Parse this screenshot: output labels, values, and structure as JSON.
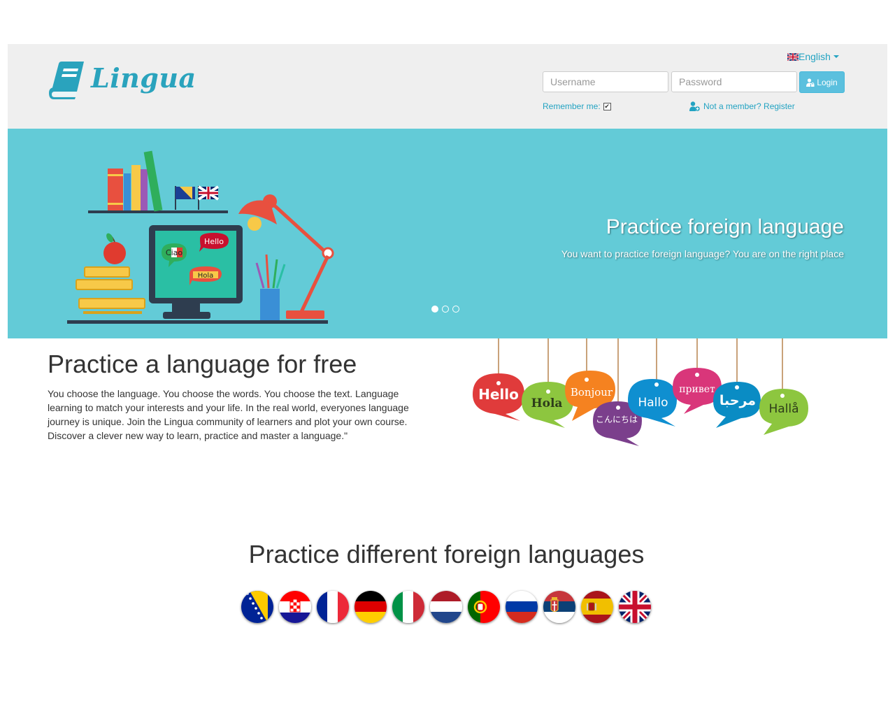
{
  "logo": {
    "text": "Lingua"
  },
  "header": {
    "language": {
      "label": "English",
      "flag": "uk-flag-icon"
    },
    "username_placeholder": "Username",
    "password_placeholder": "Password",
    "login_label": "Login",
    "remember_label": "Remember me:",
    "remember_checked": true,
    "register_label": "Not a member? Register"
  },
  "hero": {
    "title": "Practice foreign language",
    "subtitle": "You want to practice foreign language? You are on the right place",
    "slides": 3,
    "active_slide": 1,
    "art_labels": {
      "ciao": "Ciao",
      "hello": "Hello",
      "hola": "Hola"
    }
  },
  "intro": {
    "title": "Practice a language for free",
    "text": "You choose the language. You choose the words. You choose the text. Language learning to match your interests and your life. In the real world, everyones language journey is unique. Join the Lingua community of learners and plot your own course. Discover a clever new way to learn, practice and master a language.\"",
    "bubbles": [
      "Hello",
      "Hola",
      "Bonjour",
      "こんにちは",
      "Hallo",
      "привет",
      "مرحبا",
      "Hallå"
    ]
  },
  "languages": {
    "title": "Practice different foreign languages",
    "flags": [
      "bosnia",
      "croatia",
      "france",
      "germany",
      "italy",
      "netherlands",
      "portugal",
      "russia",
      "serbia",
      "spain",
      "united-kingdom"
    ]
  },
  "colors": {
    "accent": "#23a3c2",
    "hero_bg": "#63cbd7",
    "header_bg": "#efefef",
    "login_btn": "#5bc0de"
  }
}
